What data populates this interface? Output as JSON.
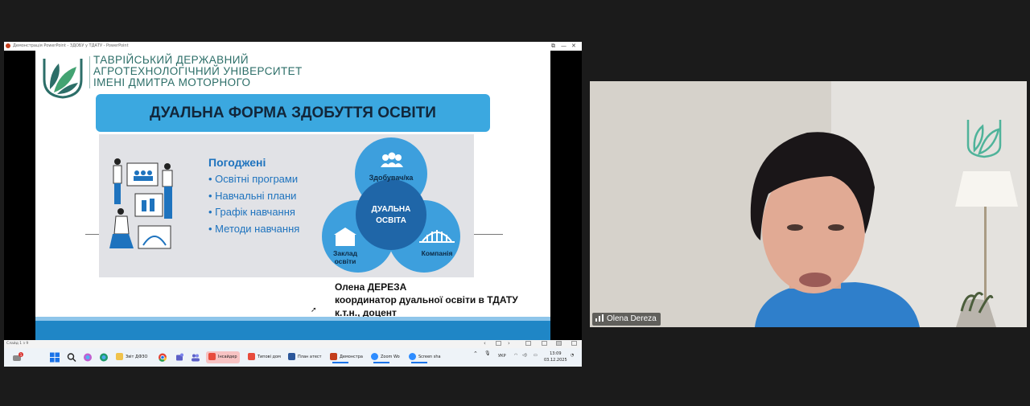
{
  "window": {
    "title": "Демонстрація PowerPoint - ЗДОБУ у ТДАТУ - PowerPoint",
    "controls": [
      "⧉",
      "—",
      "✕"
    ]
  },
  "slide": {
    "university": [
      "ТАВРІЙСЬКИЙ ДЕРЖАВНИЙ",
      "АГРОТЕХНОЛОГІЧНИЙ УНІВЕРСИТЕТ",
      "ІМЕНІ ДМИТРА МОТОРНОГО"
    ],
    "banner": "ДУАЛЬНА ФОРМА ЗДОБУТТЯ ОСВІТИ",
    "agreed_heading": "Погоджені",
    "agreed_items": [
      "Освітні програми",
      "Навчальні плани",
      "Графік навчання",
      "Методи навчання"
    ],
    "venn": {
      "top": "Здобувач/ка",
      "center_line1": "ДУАЛЬНА",
      "center_line2": "ОСВІТА",
      "left_line1": "Заклад",
      "left_line2": "освіти",
      "right": "Компанія"
    },
    "author": {
      "name": "Олена ДЕРЕЗА",
      "position": "координатор дуальної освіти в ТДАТУ",
      "degree": "к.т.н., доцент"
    }
  },
  "statusbar": {
    "slide_counter": "Слайд 1 з 9"
  },
  "taskbar": {
    "apps": [
      {
        "label": "Звіт ДФЗО",
        "color": "#f0c24b"
      },
      {
        "label": "Інсайдер",
        "color": "#e84c3d"
      },
      {
        "label": "Типові дом",
        "color": "#e84c3d"
      },
      {
        "label": "План атест",
        "color": "#2b579a"
      },
      {
        "label": "Демонстра",
        "color": "#c43e1c"
      },
      {
        "label": "Zoom Wo",
        "color": "#2d8cff"
      },
      {
        "label": "Screen sha",
        "color": "#2d8cff"
      }
    ],
    "language": "УКР",
    "time": "13:09",
    "date": "03.12.2025",
    "notification_badge": "1"
  },
  "webcam": {
    "participant": "Olena Dereza"
  },
  "colors": {
    "accent": "#3ba8e0",
    "slide_blue": "#1e73be",
    "logo_green": "#2c6e68"
  }
}
